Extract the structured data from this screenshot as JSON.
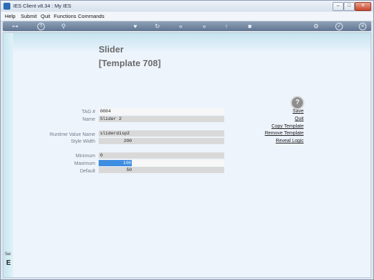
{
  "window": {
    "title": "IES Client v8.34 : My IES"
  },
  "menu": [
    "Help",
    "Submit",
    "Quit",
    "Functions",
    "Commands"
  ],
  "toolbar_icons": [
    "key-icon",
    "help-icon",
    "search-icon",
    "heart-icon",
    "refresh-icon",
    "rewind-icon",
    "forward-icon",
    "upload-icon",
    "stop-icon",
    "settings-icon",
    "check-icon",
    "close-icon"
  ],
  "page": {
    "title": "Slider",
    "subtitle": "[Template 708]"
  },
  "form": {
    "tag_label": "TAG #",
    "tag_value": "0004",
    "name_label": "Name",
    "name_value": "Slider 2",
    "runtime_label": "Runtime Value Name",
    "runtime_value": "sliderdisp2",
    "style_width_label": "Style Width",
    "style_width_value": "200",
    "minimum_label": "Minimum",
    "minimum_value": "0",
    "maximum_label": "Maximum",
    "maximum_value": "100",
    "default_label": "Default",
    "default_value": "50"
  },
  "actions": {
    "save": "Save",
    "quit": "Quit",
    "copy": "Copy Template",
    "remove": "Remove Template",
    "reveal": "Reveal Logic"
  },
  "left_strip": {
    "text": "Sei",
    "glyph": "E"
  },
  "colors": {
    "selection": "#3d8de0",
    "toolbar": "#6f839d"
  }
}
